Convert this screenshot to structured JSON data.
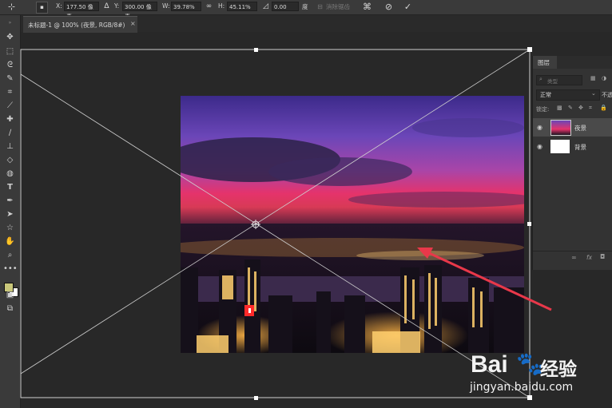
{
  "options_bar": {
    "x_label": "X:",
    "x_value": "177.50 像素",
    "y_label": "Y:",
    "y_value": "300.00 像素",
    "w_label": "W:",
    "w_value": "39.78%",
    "h_label": "H:",
    "h_value": "45.11%",
    "angle_value": "0.00",
    "angle_unit": "度",
    "interp_label": "消除锯齿"
  },
  "document": {
    "tab_title": "未标题-1 @ 100% (夜景, RGB/8#)",
    "close": "×"
  },
  "layers_panel": {
    "tab": "图层",
    "filter_placeholder": "类型",
    "blend_mode": "正常",
    "opacity_label": "不透",
    "lock_label": "锁定:",
    "layers": [
      {
        "name": "夜景",
        "selected": true
      },
      {
        "name": "背景",
        "selected": false
      }
    ],
    "footer_icons": [
      "link-icon",
      "fx-icon",
      "mask-icon"
    ],
    "footer_fx": "fx"
  },
  "watermark": {
    "brand": "Bai",
    "brand_suffix": "经验",
    "url": "jingyan.baidu.com"
  },
  "colors": {
    "foreground": "#c9c77a",
    "background": "#ffffff",
    "accent_arrow": "#e8384a"
  }
}
